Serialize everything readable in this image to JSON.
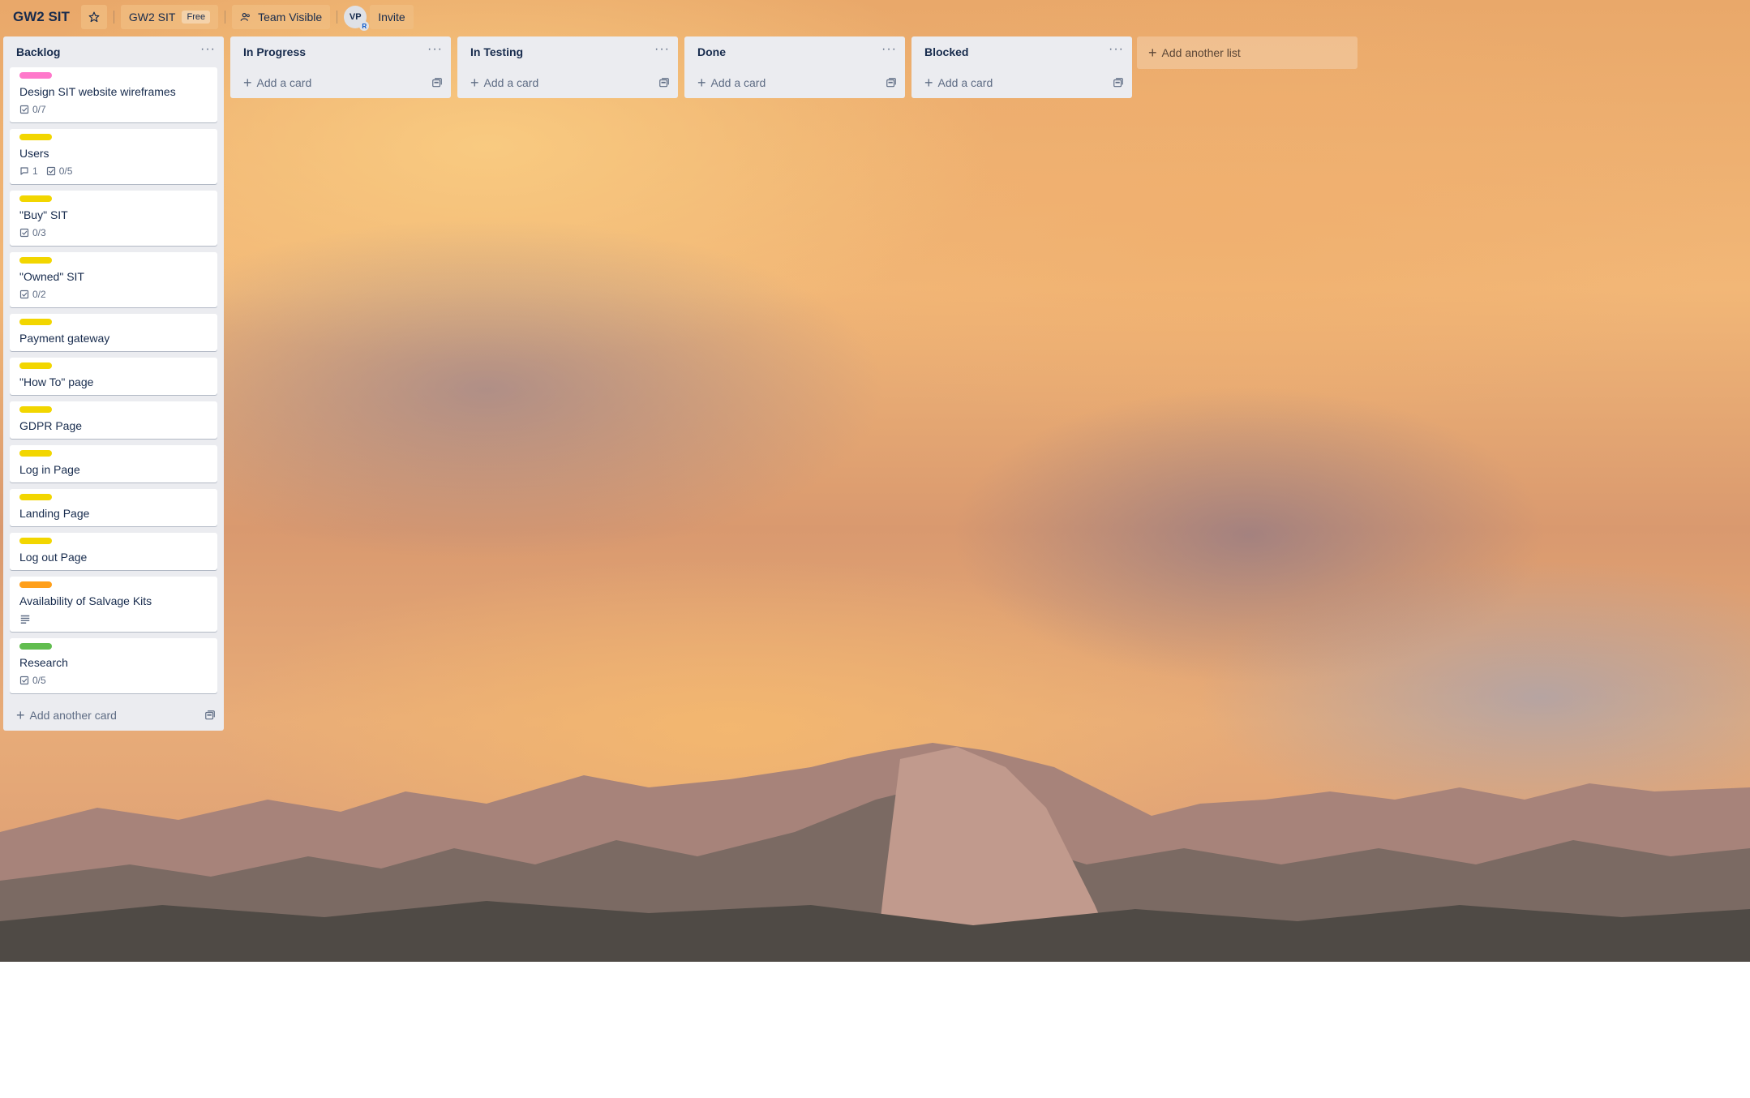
{
  "board": {
    "title": "GW2 SIT",
    "workspace": "GW2 SIT",
    "plan_badge": "Free",
    "visibility": "Team Visible",
    "member_initials": "VP",
    "member_badge": "R",
    "invite_label": "Invite"
  },
  "lists": [
    {
      "title": "Backlog",
      "add_label": "Add another card",
      "cards": [
        {
          "title": "Design SIT website wireframes",
          "label_color": "#ff78cb",
          "checklist": "0/7"
        },
        {
          "title": "Users",
          "label_color": "#f2d600",
          "comments": "1",
          "checklist": "0/5"
        },
        {
          "title": "\"Buy\" SIT",
          "label_color": "#f2d600",
          "checklist": "0/3"
        },
        {
          "title": "\"Owned\" SIT",
          "label_color": "#f2d600",
          "checklist": "0/2"
        },
        {
          "title": "Payment gateway",
          "label_color": "#f2d600"
        },
        {
          "title": "\"How To\" page",
          "label_color": "#f2d600"
        },
        {
          "title": "GDPR Page",
          "label_color": "#f2d600"
        },
        {
          "title": "Log in Page",
          "label_color": "#f2d600"
        },
        {
          "title": "Landing Page",
          "label_color": "#f2d600"
        },
        {
          "title": "Log out Page",
          "label_color": "#f2d600"
        },
        {
          "title": "Availability of Salvage Kits",
          "label_color": "#ff9f1a",
          "description_icon": "description-icon"
        },
        {
          "title": "Research",
          "label_color": "#61bd4f",
          "checklist": "0/5"
        }
      ]
    },
    {
      "title": "In Progress",
      "add_label": "Add a card",
      "cards": []
    },
    {
      "title": "In Testing",
      "add_label": "Add a card",
      "cards": []
    },
    {
      "title": "Done",
      "add_label": "Add a card",
      "cards": []
    },
    {
      "title": "Blocked",
      "add_label": "Add a card",
      "cards": []
    }
  ],
  "add_list_label": "Add another list",
  "icons": {
    "star": "star-icon",
    "team": "team-icon",
    "menu": "ellipsis-icon",
    "template": "card-template-icon",
    "checklist": "checklist-icon",
    "comment": "comment-icon"
  }
}
